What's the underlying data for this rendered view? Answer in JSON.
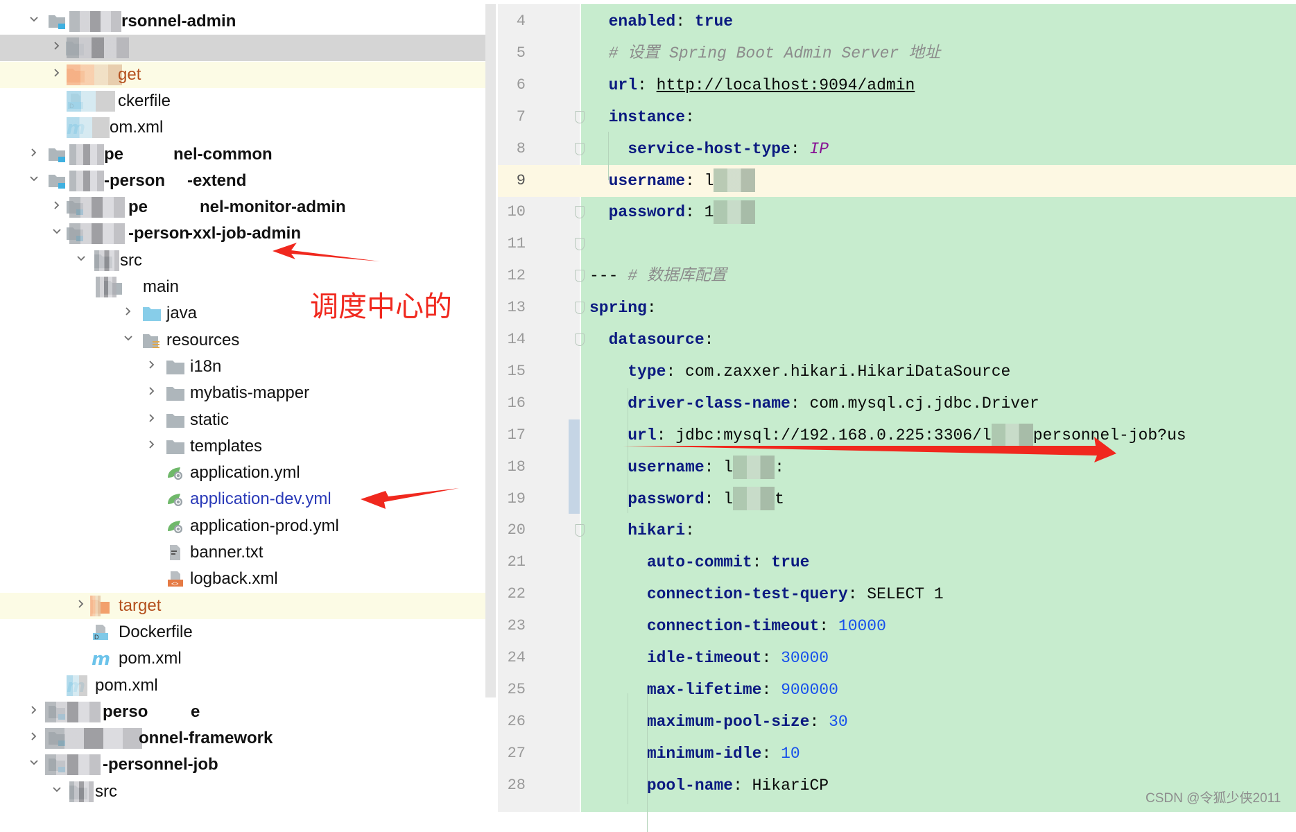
{
  "project_tree": {
    "rows": [
      {
        "label": "rsonnel-admin",
        "chevron": "down",
        "icon": "module-folder-icon",
        "variant": "bold"
      },
      {
        "label": "",
        "chevron": "right",
        "icon": "folder-icon",
        "variant": "selected"
      },
      {
        "label": "get",
        "chevron": "right",
        "icon": "excluded-folder-icon",
        "variant": "target"
      },
      {
        "label": "ckerfile",
        "chevron": "",
        "icon": "docker-file-icon",
        "variant": "plain"
      },
      {
        "label": "om.xml",
        "chevron": "",
        "icon": "maven-file-icon",
        "variant": "plain"
      },
      {
        "label": "pe",
        "label2": "nel-common",
        "chevron": "right",
        "icon": "module-folder-icon",
        "variant": "bold"
      },
      {
        "label": "-person",
        "label2": "-extend",
        "chevron": "down",
        "icon": "module-folder-icon",
        "variant": "bold"
      },
      {
        "label": "pe",
        "label2": "nel-monitor-admin",
        "chevron": "right",
        "icon": "module-folder-icon",
        "variant": "bold"
      },
      {
        "label": "-person",
        "label2": "-xxl-job-admin",
        "chevron": "down",
        "icon": "module-folder-icon",
        "variant": "bold"
      },
      {
        "label": "src",
        "chevron": "down",
        "icon": "source-folder-icon",
        "variant": "plain"
      },
      {
        "label": "main",
        "chevron": "",
        "icon": "folder-icon",
        "variant": "plain"
      },
      {
        "label": "java",
        "chevron": "right",
        "icon": "java-source-folder-icon",
        "variant": "plain"
      },
      {
        "label": "resources",
        "chevron": "down",
        "icon": "resources-folder-icon",
        "variant": "plain"
      },
      {
        "label": "i18n",
        "chevron": "right",
        "icon": "folder-icon",
        "variant": "plain"
      },
      {
        "label": "mybatis-mapper",
        "chevron": "right",
        "icon": "folder-icon",
        "variant": "plain"
      },
      {
        "label": "static",
        "chevron": "right",
        "icon": "folder-icon",
        "variant": "plain"
      },
      {
        "label": "templates",
        "chevron": "right",
        "icon": "folder-icon",
        "variant": "plain"
      },
      {
        "label": "application.yml",
        "chevron": "",
        "icon": "spring-yaml-icon",
        "variant": "plain"
      },
      {
        "label": "application-dev.yml",
        "chevron": "",
        "icon": "spring-yaml-icon",
        "variant": "modified"
      },
      {
        "label": "application-prod.yml",
        "chevron": "",
        "icon": "spring-yaml-icon",
        "variant": "plain"
      },
      {
        "label": "banner.txt",
        "chevron": "",
        "icon": "text-file-icon",
        "variant": "plain"
      },
      {
        "label": "logback.xml",
        "chevron": "",
        "icon": "xml-file-icon",
        "variant": "plain"
      },
      {
        "label": "target",
        "chevron": "right",
        "icon": "excluded-folder-icon",
        "variant": "target"
      },
      {
        "label": "Dockerfile",
        "chevron": "",
        "icon": "docker-file-icon",
        "variant": "plain"
      },
      {
        "label": "pom.xml",
        "chevron": "",
        "icon": "maven-file-icon",
        "variant": "plain"
      },
      {
        "label": "pom.xml",
        "chevron": "",
        "icon": "maven-file-icon",
        "variant": "plain"
      },
      {
        "label": "perso",
        "label2": "e",
        "chevron": "right",
        "icon": "module-folder-icon",
        "variant": "bold"
      },
      {
        "label": "onnel-framework",
        "chevron": "right",
        "icon": "module-folder-icon",
        "variant": "bold"
      },
      {
        "label": "-personnel-job",
        "chevron": "down",
        "icon": "module-folder-icon",
        "variant": "bold"
      },
      {
        "label": "src",
        "chevron": "down",
        "icon": "source-folder-icon",
        "variant": "plain"
      }
    ]
  },
  "annotation": {
    "text": "调度中心的",
    "color": "#f0281e"
  },
  "editor": {
    "current_line": 9,
    "background": "#c7ecce",
    "lines": [
      {
        "n": "4",
        "t": [
          [
            "  ",
            "p"
          ],
          [
            "enabled",
            "key"
          ],
          [
            ": ",
            "p"
          ],
          [
            "true",
            "kw"
          ]
        ]
      },
      {
        "n": "5",
        "t": [
          [
            "  # 设置 Spring Boot Admin Server 地址",
            "cmt"
          ]
        ]
      },
      {
        "n": "6",
        "t": [
          [
            "  ",
            "p"
          ],
          [
            "url",
            "key"
          ],
          [
            ": ",
            "p"
          ],
          [
            "http://localhost:9094/admin",
            "url"
          ]
        ]
      },
      {
        "n": "7",
        "t": [
          [
            "  ",
            "p"
          ],
          [
            "instance",
            "key"
          ],
          [
            ":",
            "p"
          ]
        ]
      },
      {
        "n": "8",
        "t": [
          [
            "    ",
            "p"
          ],
          [
            "service-host-type",
            "key"
          ],
          [
            ": ",
            "p"
          ],
          [
            "IP",
            "const"
          ]
        ]
      },
      {
        "n": "9",
        "t": [
          [
            "  ",
            "p"
          ],
          [
            "username",
            "key"
          ],
          [
            ": ",
            "p"
          ],
          [
            "l",
            "p"
          ],
          [
            "",
            "blur"
          ]
        ]
      },
      {
        "n": "10",
        "t": [
          [
            "  ",
            "p"
          ],
          [
            "password",
            "key"
          ],
          [
            ": ",
            "p"
          ],
          [
            "1",
            "p"
          ],
          [
            "",
            "blur"
          ]
        ]
      },
      {
        "n": "11",
        "t": []
      },
      {
        "n": "12",
        "t": [
          [
            "--- ",
            "p"
          ],
          [
            "# 数据库配置",
            "cmt"
          ]
        ]
      },
      {
        "n": "13",
        "t": [
          [
            "spring",
            "key"
          ],
          [
            ":",
            "p"
          ]
        ]
      },
      {
        "n": "14",
        "t": [
          [
            "  ",
            "p"
          ],
          [
            "datasource",
            "key"
          ],
          [
            ":",
            "p"
          ]
        ]
      },
      {
        "n": "15",
        "t": [
          [
            "    ",
            "p"
          ],
          [
            "type",
            "key"
          ],
          [
            ": com.zaxxer.hikari.HikariDataSource",
            "p"
          ]
        ]
      },
      {
        "n": "16",
        "t": [
          [
            "    ",
            "p"
          ],
          [
            "driver-class-name",
            "key"
          ],
          [
            ": com.mysql.cj.jdbc.Driver",
            "p"
          ]
        ]
      },
      {
        "n": "17",
        "t": [
          [
            "    ",
            "p"
          ],
          [
            "url",
            "key"
          ],
          [
            ": jdbc:mysql://192.168.0.225:3306/l",
            "p"
          ],
          [
            "",
            "blur"
          ],
          [
            "personnel-job?us",
            "p"
          ]
        ]
      },
      {
        "n": "18",
        "t": [
          [
            "    ",
            "p"
          ],
          [
            "username",
            "key"
          ],
          [
            ": l",
            "p"
          ],
          [
            "",
            "blur"
          ],
          [
            ":",
            "p"
          ]
        ]
      },
      {
        "n": "19",
        "t": [
          [
            "    ",
            "p"
          ],
          [
            "password",
            "key"
          ],
          [
            ": l",
            "p"
          ],
          [
            "",
            "blur"
          ],
          [
            "t",
            "p"
          ]
        ]
      },
      {
        "n": "20",
        "t": [
          [
            "    ",
            "p"
          ],
          [
            "hikari",
            "key"
          ],
          [
            ":",
            "p"
          ]
        ]
      },
      {
        "n": "21",
        "t": [
          [
            "      ",
            "p"
          ],
          [
            "auto-commit",
            "key"
          ],
          [
            ": ",
            "p"
          ],
          [
            "true",
            "kw"
          ]
        ]
      },
      {
        "n": "22",
        "t": [
          [
            "      ",
            "p"
          ],
          [
            "connection-test-query",
            "key"
          ],
          [
            ": SELECT 1",
            "p"
          ]
        ]
      },
      {
        "n": "23",
        "t": [
          [
            "      ",
            "p"
          ],
          [
            "connection-timeout",
            "key"
          ],
          [
            ": ",
            "p"
          ],
          [
            "10000",
            "num"
          ]
        ]
      },
      {
        "n": "24",
        "t": [
          [
            "      ",
            "p"
          ],
          [
            "idle-timeout",
            "key"
          ],
          [
            ": ",
            "p"
          ],
          [
            "30000",
            "num"
          ]
        ]
      },
      {
        "n": "25",
        "t": [
          [
            "      ",
            "p"
          ],
          [
            "max-lifetime",
            "key"
          ],
          [
            ": ",
            "p"
          ],
          [
            "900000",
            "num"
          ]
        ]
      },
      {
        "n": "26",
        "t": [
          [
            "      ",
            "p"
          ],
          [
            "maximum-pool-size",
            "key"
          ],
          [
            ": ",
            "p"
          ],
          [
            "30",
            "num"
          ]
        ]
      },
      {
        "n": "27",
        "t": [
          [
            "      ",
            "p"
          ],
          [
            "minimum-idle",
            "key"
          ],
          [
            ": ",
            "p"
          ],
          [
            "10",
            "num"
          ]
        ]
      },
      {
        "n": "28",
        "t": [
          [
            "      ",
            "p"
          ],
          [
            "pool-name",
            "key"
          ],
          [
            ": HikariCP",
            "p"
          ]
        ]
      }
    ]
  },
  "watermark": "CSDN @令狐少侠2011"
}
